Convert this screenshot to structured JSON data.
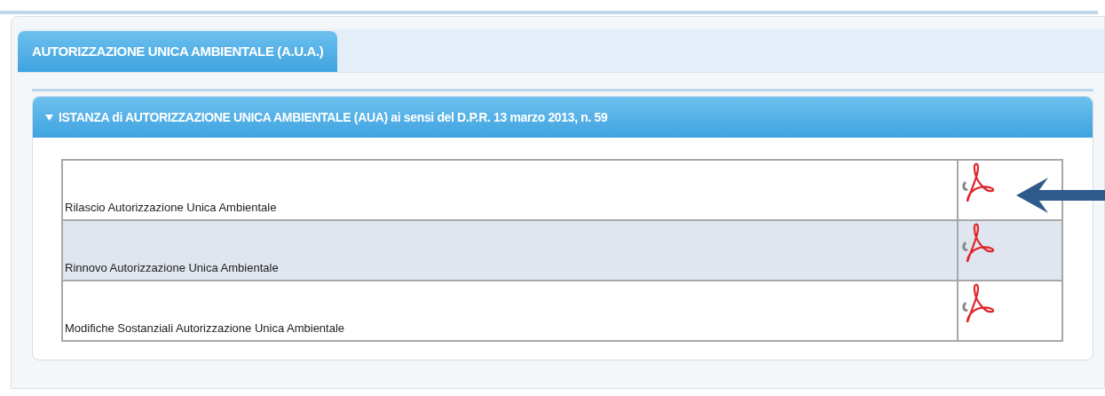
{
  "tab": {
    "label": "AUTORIZZAZIONE UNICA AMBIENTALE (A.U.A.)",
    "selected": true
  },
  "section": {
    "title": "ISTANZA di AUTORIZZAZIONE UNICA AMBIENTALE (AUA) ai sensi del D.P.R. 13 marzo 2013, n. 59",
    "expanded": true,
    "rows": [
      {
        "label": "Rilascio Autorizzazione Unica Ambientale"
      },
      {
        "label": "Rinnovo Autorizzazione Unica Ambientale"
      },
      {
        "label": "Modifiche Sostanziali Autorizzazione Unica Ambientale"
      }
    ]
  }
}
